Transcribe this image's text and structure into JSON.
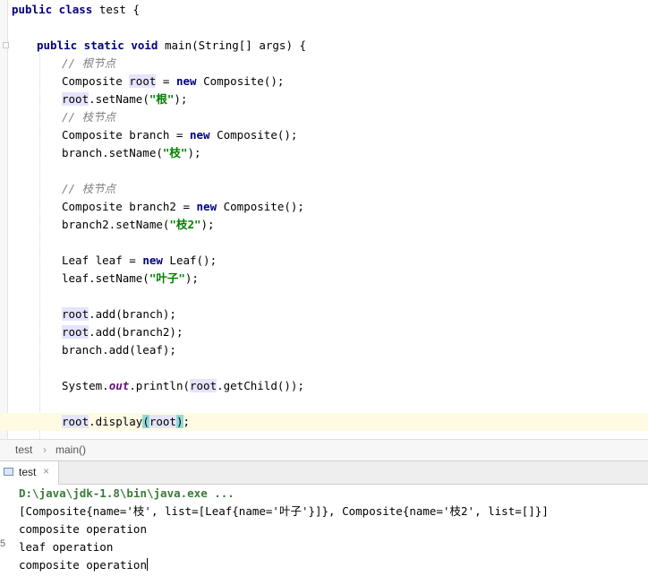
{
  "editor": {
    "lines": [
      [
        [
          "kw",
          "public class "
        ],
        [
          "",
          "test {"
        ]
      ],
      [],
      [
        [
          "kw",
          "public static void "
        ],
        [
          "",
          "main(String[] args) {"
        ]
      ],
      [
        [
          "cm",
          "// 根节点"
        ]
      ],
      [
        [
          "",
          "Composite "
        ],
        [
          "hl",
          "root"
        ],
        [
          "",
          " = "
        ],
        [
          "kw",
          "new "
        ],
        [
          "",
          "Composite();"
        ]
      ],
      [
        [
          "hl",
          "root"
        ],
        [
          "",
          ".setName("
        ],
        [
          "st",
          "\"根\""
        ],
        [
          "",
          ");"
        ]
      ],
      [
        [
          "cm",
          "// 枝节点"
        ]
      ],
      [
        [
          "",
          "Composite branch = "
        ],
        [
          "kw",
          "new "
        ],
        [
          "",
          "Composite();"
        ]
      ],
      [
        [
          "",
          "branch.setName("
        ],
        [
          "st",
          "\"枝\""
        ],
        [
          "",
          ");"
        ]
      ],
      [],
      [
        [
          "cm",
          "// 枝节点"
        ]
      ],
      [
        [
          "",
          "Composite branch2 = "
        ],
        [
          "kw",
          "new "
        ],
        [
          "",
          "Composite();"
        ]
      ],
      [
        [
          "",
          "branch2.setName("
        ],
        [
          "st",
          "\"枝2\""
        ],
        [
          "",
          ");"
        ]
      ],
      [],
      [
        [
          "",
          "Leaf leaf = "
        ],
        [
          "kw",
          "new "
        ],
        [
          "",
          "Leaf();"
        ]
      ],
      [
        [
          "",
          "leaf.setName("
        ],
        [
          "st",
          "\"叶子\""
        ],
        [
          "",
          ");"
        ]
      ],
      [],
      [
        [
          "hl",
          "root"
        ],
        [
          "",
          ".add(branch);"
        ]
      ],
      [
        [
          "hl",
          "root"
        ],
        [
          "",
          ".add(branch2);"
        ]
      ],
      [
        [
          "",
          "branch.add(leaf);"
        ]
      ],
      [],
      [
        [
          "",
          "System."
        ],
        [
          "fld",
          "out"
        ],
        [
          "",
          ".println("
        ],
        [
          "hl",
          "root"
        ],
        [
          "",
          ".getChild());"
        ]
      ],
      [],
      [
        [
          "hl",
          "root"
        ],
        [
          "",
          ".display"
        ],
        [
          "br",
          "("
        ],
        [
          "hl",
          "root"
        ],
        [
          "br",
          ")"
        ],
        [
          "",
          ";"
        ]
      ]
    ]
  },
  "breadcrumb": {
    "items": [
      "test",
      "main()"
    ],
    "separator": "›"
  },
  "run_panel": {
    "tab_label": "test",
    "close_glyph": "×",
    "console_lines": [
      "D:\\java\\jdk-1.8\\bin\\java.exe ...",
      "[Composite{name='枝', list=[Leaf{name='叶子'}]}, Composite{name='枝2', list=[]}]",
      "composite operation",
      "leaf operation",
      "composite operation"
    ],
    "left_edge_mark": "5"
  },
  "colors": {
    "keyword": "#000080",
    "comment": "#808080",
    "string": "#008000",
    "static_field": "#660e7a",
    "identifier_highlight": "#e4e4ff",
    "brace_match": "#93d9d9",
    "current_line": "#fffae3",
    "console_command": "#3a7a3a"
  }
}
